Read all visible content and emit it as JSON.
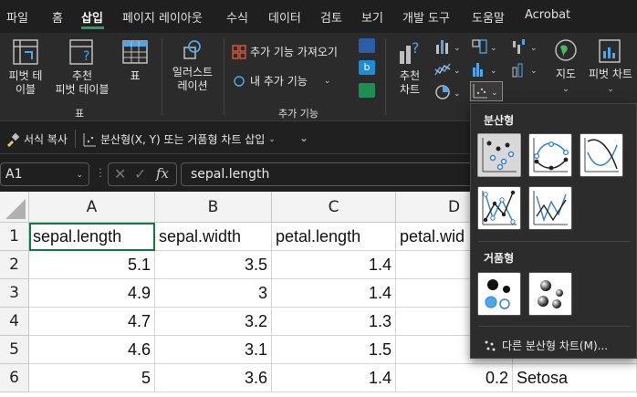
{
  "menu": {
    "tabs": [
      "파일",
      "홈",
      "삽입",
      "페이지 레이아웃",
      "수식",
      "데이터",
      "검토",
      "보기",
      "개발 도구",
      "도움말",
      "Acrobat"
    ],
    "active": "삽입"
  },
  "ribbon": {
    "pivot_table": "피벗 테\n이블",
    "recommended_pivot": "추천\n피벗 테이블",
    "table": "표",
    "tables_group": "표",
    "illustrations": "일러스트\n레이션",
    "get_addins": "추가 기능 가져오기",
    "my_addins": "내 추가 기능",
    "addins_group": "추가 기능",
    "recommended_charts": "추천\n차트",
    "maps": "지도",
    "pivot_chart": "피벗 차트"
  },
  "qat": {
    "format_painter": "서식 복사",
    "insert_scatter": "분산형(X, Y) 또는 거품형 차트 삽입"
  },
  "formula_bar": {
    "name_box": "A1",
    "formula": "sepal.length",
    "fx": "fx"
  },
  "grid": {
    "columns": [
      "A",
      "B",
      "C",
      "D"
    ],
    "rows": [
      {
        "num": "1",
        "cells": [
          "sepal.length",
          "sepal.width",
          "petal.length",
          "petal.wid"
        ]
      },
      {
        "num": "2",
        "cells": [
          "5.1",
          "3.5",
          "1.4",
          ""
        ]
      },
      {
        "num": "3",
        "cells": [
          "4.9",
          "3",
          "1.4",
          ""
        ]
      },
      {
        "num": "4",
        "cells": [
          "4.7",
          "3.2",
          "1.3",
          ""
        ]
      },
      {
        "num": "5",
        "cells": [
          "4.6",
          "3.1",
          "1.5",
          "0.2"
        ]
      },
      {
        "num": "6",
        "cells": [
          "5",
          "3.6",
          "1.4",
          "0.2"
        ]
      }
    ],
    "e_col": [
      "",
      "",
      "",
      "",
      "Setosa",
      "Setosa"
    ]
  },
  "dropdown": {
    "scatter_header": "분산형",
    "bubble_header": "거품형",
    "more": "다른 분산형 차트(M)..."
  },
  "colors": {
    "accent": "#21a366",
    "selection": "#107c41"
  }
}
